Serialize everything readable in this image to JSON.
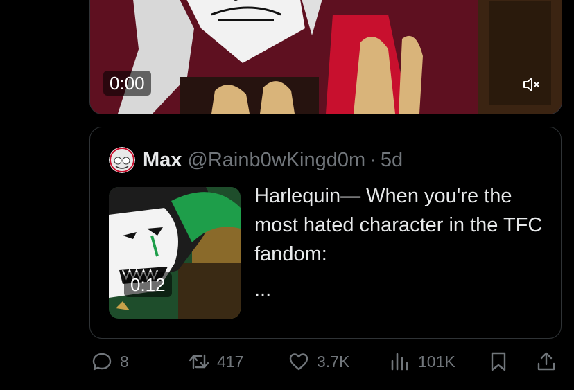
{
  "video_post": {
    "time": "0:00",
    "mute_icon": "speaker-muted-icon"
  },
  "quote": {
    "name": "Max",
    "handle": "@Rainb0wKingd0m",
    "separator": "·",
    "age": "5d",
    "text": "Harlequin— When you're the most hated character in the TFC fandom:",
    "ellipsis": "...",
    "video_time": "0:12"
  },
  "actions": {
    "replies": "8",
    "reposts": "417",
    "likes": "3.7K",
    "views": "101K"
  },
  "colors": {
    "background": "#000000",
    "text": "#e7e9ea",
    "muted": "#71767b",
    "border": "#2f3336"
  }
}
